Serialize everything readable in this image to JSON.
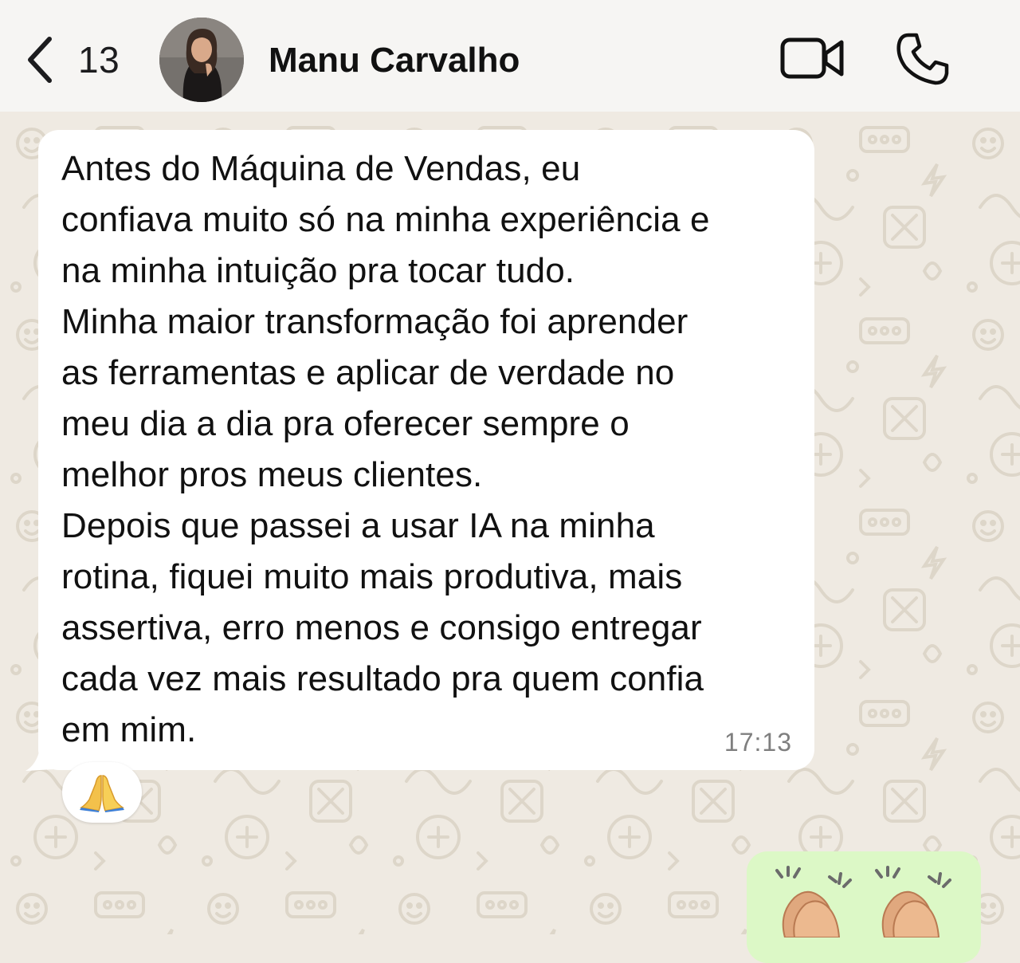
{
  "header": {
    "back_label": "13",
    "contact_name": "Manu Carvalho",
    "icons": {
      "back": "chevron-left-icon",
      "video": "video-camera-icon",
      "call": "phone-icon"
    }
  },
  "messages": [
    {
      "direction": "incoming",
      "text": "Antes do Máquina de Vendas, eu\nconfiava muito só na minha experiência e\nna minha intuição pra tocar tudo.\nMinha maior transformação foi aprender\nas ferramentas e aplicar de verdade no\nmeu dia a dia pra oferecer sempre o\nmelhor pros meus clientes.\nDepois que passei a usar IA na minha\nrotina, fiquei muito mais produtiva, mais\nassertiva, erro menos e consigo entregar\ncada vez mais resultado pra quem confia\nem mim.",
      "time": "17:13",
      "reaction": "🙏"
    },
    {
      "direction": "outgoing",
      "content": "clapping-hands-emoji x2"
    }
  ],
  "colors": {
    "chat_background": "#efeae2",
    "header_background": "#f6f5f3",
    "incoming_bubble": "#ffffff",
    "outgoing_bubble": "#dcf8c6",
    "timestamp": "#7f7f7f"
  }
}
